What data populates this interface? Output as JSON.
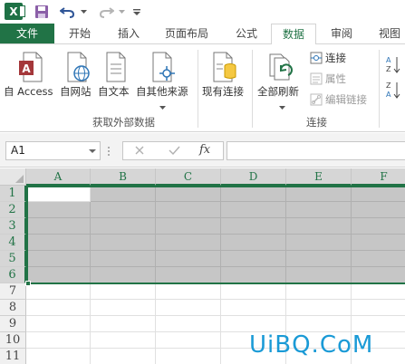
{
  "tabs": {
    "file": "文件",
    "home": "开始",
    "insert": "插入",
    "page_layout": "页面布局",
    "formulas": "公式",
    "data": "数据",
    "review": "审阅",
    "view": "视图"
  },
  "ribbon": {
    "external_data": {
      "title": "获取外部数据",
      "from_access": "自 Access",
      "from_web": "自网站",
      "from_text": "自文本",
      "from_other": "自其他来源",
      "existing_connections": "现有连接"
    },
    "connections": {
      "title": "连接",
      "refresh_all": "全部刷新",
      "connections": "连接",
      "properties": "属性",
      "edit_links": "编辑链接"
    }
  },
  "formula_bar": {
    "name_box": "A1",
    "fx": "fx",
    "formula": ""
  },
  "grid": {
    "columns": [
      "A",
      "B",
      "C",
      "D",
      "E",
      "F"
    ],
    "rows": [
      "1",
      "2",
      "3",
      "4",
      "5",
      "6",
      "7",
      "8",
      "9",
      "10",
      "11"
    ]
  },
  "watermark": "UiBQ.CoM",
  "colors": {
    "accent": "#217346",
    "selection": "#c6c6c6",
    "watermark": "#1a9ad6"
  }
}
